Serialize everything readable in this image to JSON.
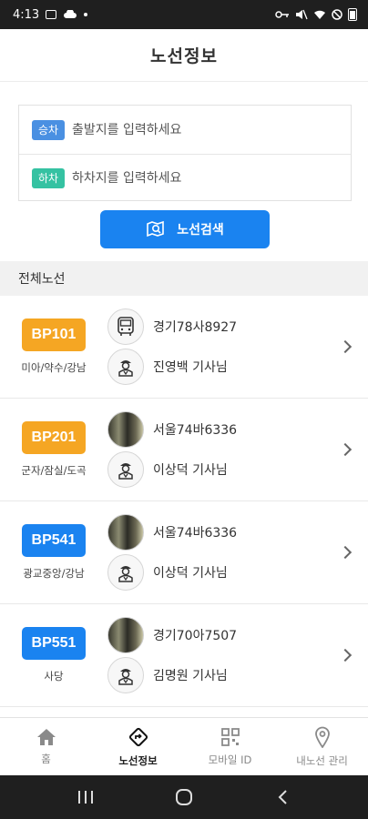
{
  "status_bar": {
    "time": "4:13"
  },
  "header": {
    "title": "노선정보"
  },
  "search": {
    "board_tag": "승차",
    "board_placeholder": "출발지를 입력하세요",
    "alight_tag": "하차",
    "alight_placeholder": "하차지를 입력하세요",
    "button_label": "노선검색"
  },
  "section": {
    "title": "전체노선"
  },
  "routes": [
    {
      "code": "BP101",
      "area": "미아/약수/강남",
      "plate": "경기78사8927",
      "driver": "진영백 기사님",
      "color": "#f5a623"
    },
    {
      "code": "BP201",
      "area": "군자/잠실/도곡",
      "plate": "서울74바6336",
      "driver": "이상덕 기사님",
      "color": "#f5a623"
    },
    {
      "code": "BP541",
      "area": "광교중앙/강남",
      "plate": "서울74바6336",
      "driver": "이상덕 기사님",
      "color": "#1a83f0"
    },
    {
      "code": "BP551",
      "area": "사당",
      "plate": "경기70아7507",
      "driver": "김명원 기사님",
      "color": "#1a83f0"
    }
  ],
  "bottom_nav": {
    "home": "홈",
    "route_info": "노선정보",
    "mobile_id": "모바일 ID",
    "my_route": "내노선 관리"
  },
  "colors": {
    "accent": "#1a83f0",
    "orange": "#f5a623",
    "board_tag": "#4a90e2",
    "alight_tag": "#35c2a2"
  }
}
